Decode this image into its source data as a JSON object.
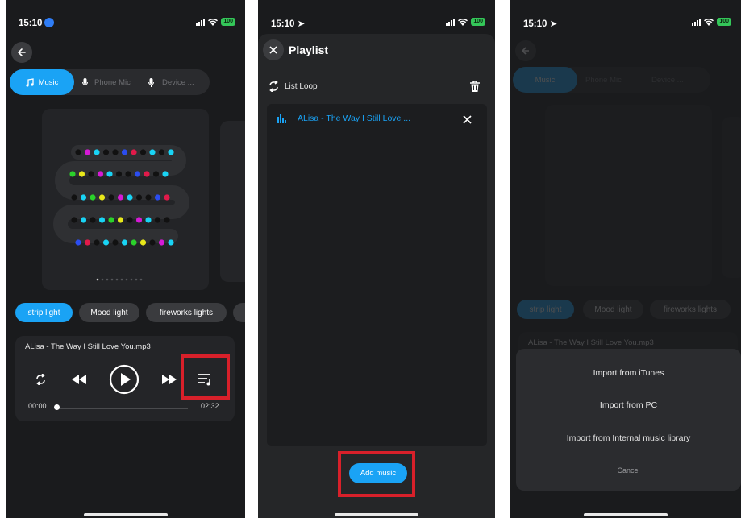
{
  "status_bar": {
    "time": "15:10",
    "battery": "100"
  },
  "screen1": {
    "sources": [
      {
        "label": "Music",
        "icon": "music-note-icon"
      },
      {
        "label": "Phone Mic",
        "icon": "microphone-icon"
      },
      {
        "label": "Device ...",
        "icon": "microphone-icon"
      }
    ],
    "effect_tabs": [
      "strip light",
      "Mood light",
      "fireworks lights"
    ],
    "now_playing": "ALisa - The Way I Still Love You.mp3",
    "time_elapsed": "00:00",
    "time_total": "02:32",
    "progress": 0.0,
    "accent_color": "#1aa3f5",
    "highlight_color": "#d8202a"
  },
  "screen2": {
    "title": "Playlist",
    "loop_mode": "List Loop",
    "tracks": [
      "ALisa - The Way I Still Love ..."
    ],
    "add_button": "Add music"
  },
  "screen3": {
    "background_now_playing": "ALisa - The Way I Still Love You.mp3",
    "import_options": [
      "Import from iTunes",
      "Import from PC",
      "Import from Internal music library"
    ],
    "cancel": "Cancel"
  }
}
